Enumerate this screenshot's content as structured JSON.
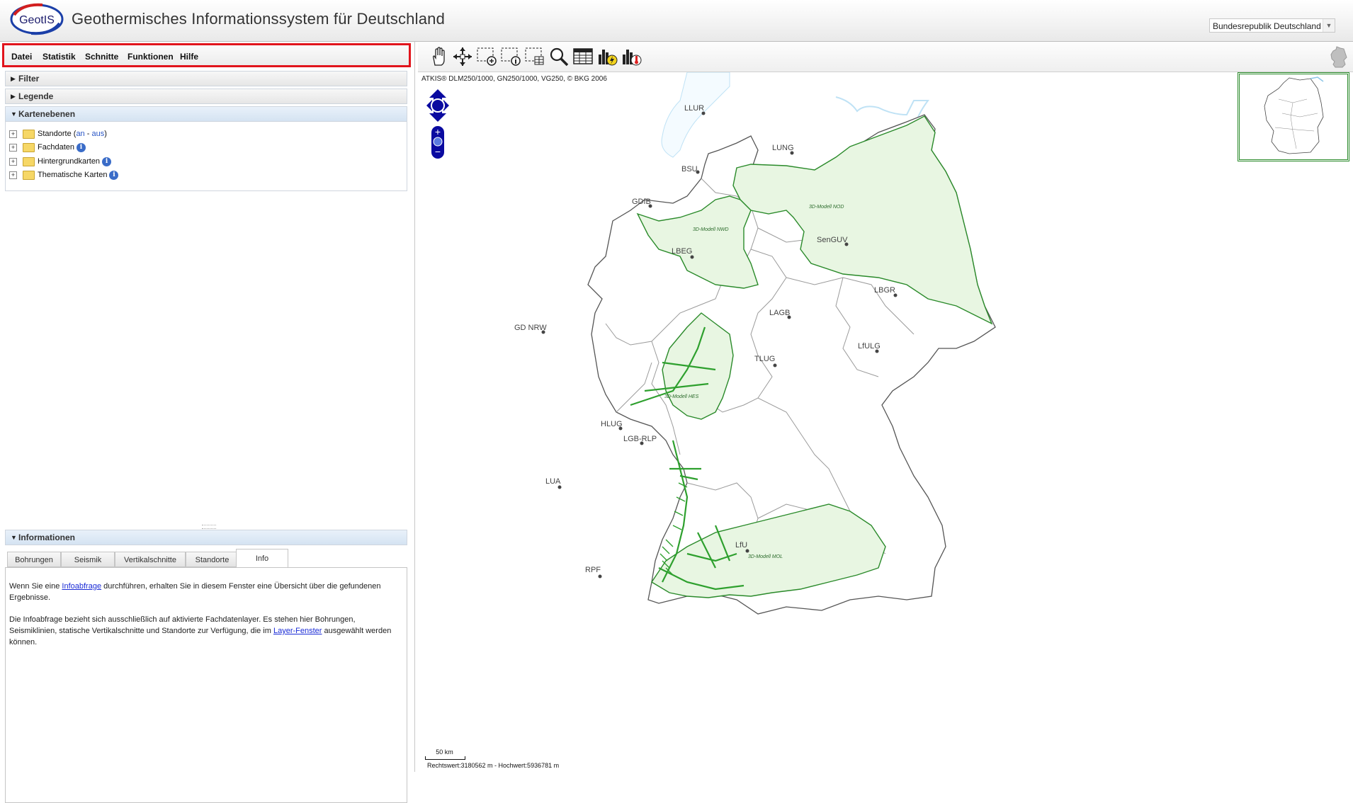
{
  "header": {
    "logo_text": "GeotIS",
    "title": "Geothermisches Informationssystem für Deutschland",
    "region_select": "Bundesrepublik Deutschland"
  },
  "menu": [
    "Datei",
    "Statistik",
    "Schnitte",
    "Funktionen",
    "Hilfe"
  ],
  "panels": {
    "filter": "Filter",
    "legende": "Legende",
    "kartenebenen": "Kartenebenen",
    "informationen": "Informationen"
  },
  "layers": [
    {
      "label": "Standorte",
      "extra_prefix": "(",
      "extra_an": "an",
      "extra_sep": " - ",
      "extra_aus": "aus",
      "extra_suffix": ")"
    },
    {
      "label": "Fachdaten",
      "info_icon": "info-icon"
    },
    {
      "label": "Hintergrundkarten",
      "info_icon": "info-icon"
    },
    {
      "label": "Thematische Karten",
      "info_icon": "info-icon"
    }
  ],
  "info_tabs": [
    "Bohrungen",
    "Seismik",
    "Vertikalschnitte",
    "Standorte",
    "Info"
  ],
  "info_active_tab": "Info",
  "info_text": {
    "p1_before": "Wenn Sie eine ",
    "p1_link": "Infoabfrage",
    "p1_after": " durchführen, erhalten Sie in diesem Fenster eine Übersicht über die gefundenen Ergebnisse.",
    "p2_before": "Die Infoabfrage bezieht sich ausschließlich auf aktivierte Fachdatenlayer. Es stehen hier Bohrungen, Seismiklinien, statische Vertikalschnitte und Standorte zur Verfügung, die im ",
    "p2_link": "Layer-Fenster",
    "p2_after": " ausgewählt werden können."
  },
  "toolbar": [
    "pan-hand-icon",
    "zoom-extent-icon",
    "zoom-box-icon",
    "info-box-icon",
    "table-select-icon",
    "search-magnifier-icon",
    "attribute-table-icon",
    "statistics-power-icon",
    "statistics-temperature-icon"
  ],
  "map": {
    "copyright": "ATKIS® DLM250/1000, GN250/1000, VG250, © BKG 2006",
    "scale_label": "50 km",
    "coords": "Rechtswert:3180562 m - Hochwert:5936781 m",
    "cities": [
      "LLUR",
      "LUNG",
      "BSU",
      "GDfB",
      "SenGUV",
      "LBEG",
      "LBGR",
      "LAGB",
      "GD NRW",
      "LfULG",
      "TLUG",
      "HLUG",
      "LGB-RLP",
      "LUA",
      "LfU",
      "RPF"
    ],
    "model_labels": [
      "3D-Modell NOD",
      "3D-Modell NWD",
      "3D-Modell HES",
      "3D-Modell MOL"
    ],
    "colors": {
      "model_fill": "#e6f5e0",
      "model_line": "#2a8a2a",
      "border": "#9a9a9a",
      "water": "#bfe2f5"
    }
  }
}
